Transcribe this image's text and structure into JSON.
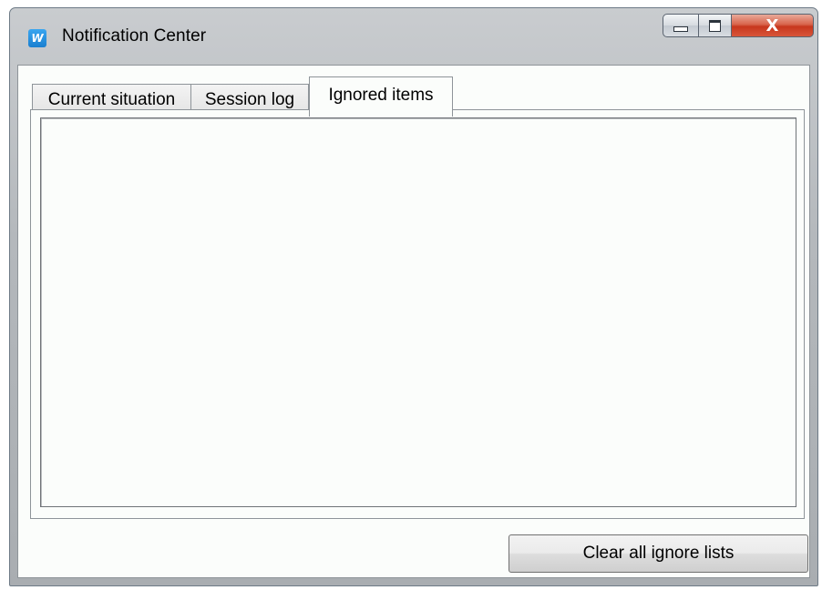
{
  "window": {
    "title": "Notification Center",
    "app_icon_letter": "W",
    "close_glyph": "X"
  },
  "tabs": [
    {
      "label": "Current situation",
      "active": false
    },
    {
      "label": "Session log",
      "active": false
    },
    {
      "label": "Ignored items",
      "active": true
    }
  ],
  "ignored_items": {
    "items": []
  },
  "footer": {
    "clear_button_label": "Clear all ignore lists"
  },
  "colors": {
    "close_button": "#c7371d",
    "app_icon": "#1a7fd0",
    "client_background": "#fbfdfb"
  }
}
